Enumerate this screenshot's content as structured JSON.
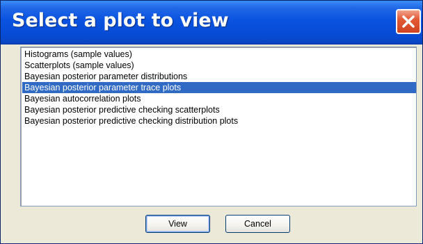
{
  "window": {
    "title": "Select a plot to view",
    "close_icon": "close-x-icon"
  },
  "plot_list": {
    "items": [
      "Histograms (sample values)",
      "Scatterplots (sample values)",
      "Bayesian posterior parameter distributions",
      "Bayesian posterior parameter trace plots",
      "Bayesian autocorrelation plots",
      "Bayesian posterior predictive checking scatterplots",
      "Bayesian posterior predictive checking distribution plots"
    ],
    "selected": "Bayesian posterior parameter trace plots"
  },
  "buttons": {
    "view_label": "View",
    "cancel_label": "Cancel"
  },
  "colors": {
    "titlebar": "#0a53e0",
    "selection": "#316ac5",
    "close_button": "#e25a36",
    "dialog_face": "#ece9d8"
  }
}
